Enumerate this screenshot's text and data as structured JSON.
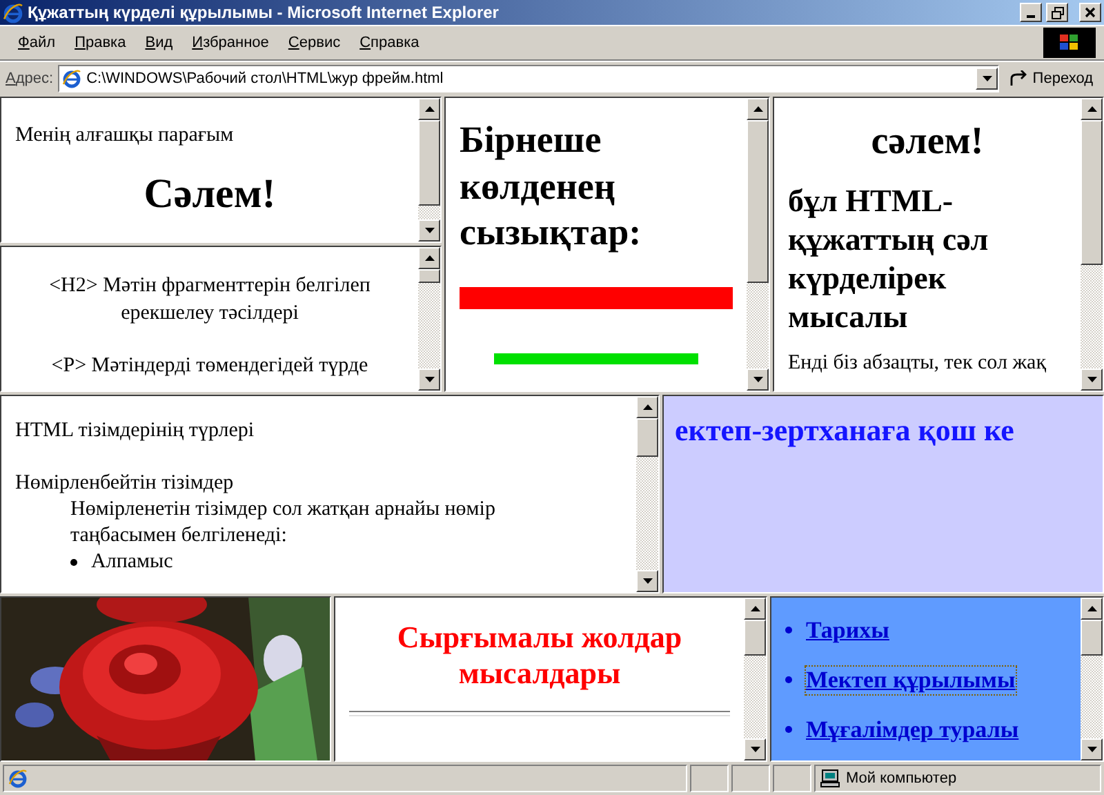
{
  "window": {
    "title": "Құжаттың күрделі құрылымы - Microsoft Internet Explorer"
  },
  "menu": [
    "Файл",
    "Правка",
    "Вид",
    "Избранное",
    "Сервис",
    "Справка"
  ],
  "address_bar": {
    "label": "Адрес:",
    "value": "C:\\WINDOWS\\Рабочий стол\\HTML\\жур фрейм.html",
    "go_button": "Переход"
  },
  "frame_intro": {
    "caption": "Менің алғашқы парағым",
    "heading": "Сәлем!"
  },
  "frame_tags": {
    "lines": [
      "<H2> Мәтін фрагменттерін белгілеп ерекшелеу тәсілдері",
      "<P> Мәтіндерді төмендегідей түрде"
    ]
  },
  "frame_rules": {
    "heading": "Бірнеше көлденең сызықтар:",
    "rules": [
      {
        "kind": "thick",
        "color": "#ff0000"
      },
      {
        "kind": "thin",
        "color": "#00e000"
      }
    ]
  },
  "frame_greeting": {
    "heading": "сәлем!",
    "subheading": "бұл HTML-құжаттың сәл күрделірек мысалы",
    "paragraph": "Енді біз абзацты, тек сол жақ"
  },
  "frame_lists": {
    "title": "HTML тізімдерінің түрлері",
    "subtitle": "Нөмірленбейтін тізімдер",
    "description": "Нөмірленетін тізімдер сол жатқан арнайы нөмір таңбасымен белгіленеді:",
    "items": [
      "Алпамыс"
    ]
  },
  "frame_marquee": {
    "text": "ектеп-зертханаға қош ке"
  },
  "frame_scrolling": {
    "heading": "Сырғымалы жолдар мысалдары"
  },
  "frame_links": {
    "links": [
      {
        "label": "Тарихы",
        "focused": false
      },
      {
        "label": "Мектеп құрылымы",
        "focused": true
      },
      {
        "label": "Мұғалімдер туралы",
        "focused": false
      }
    ]
  },
  "status_bar": {
    "zone": "Мой компьютер"
  }
}
